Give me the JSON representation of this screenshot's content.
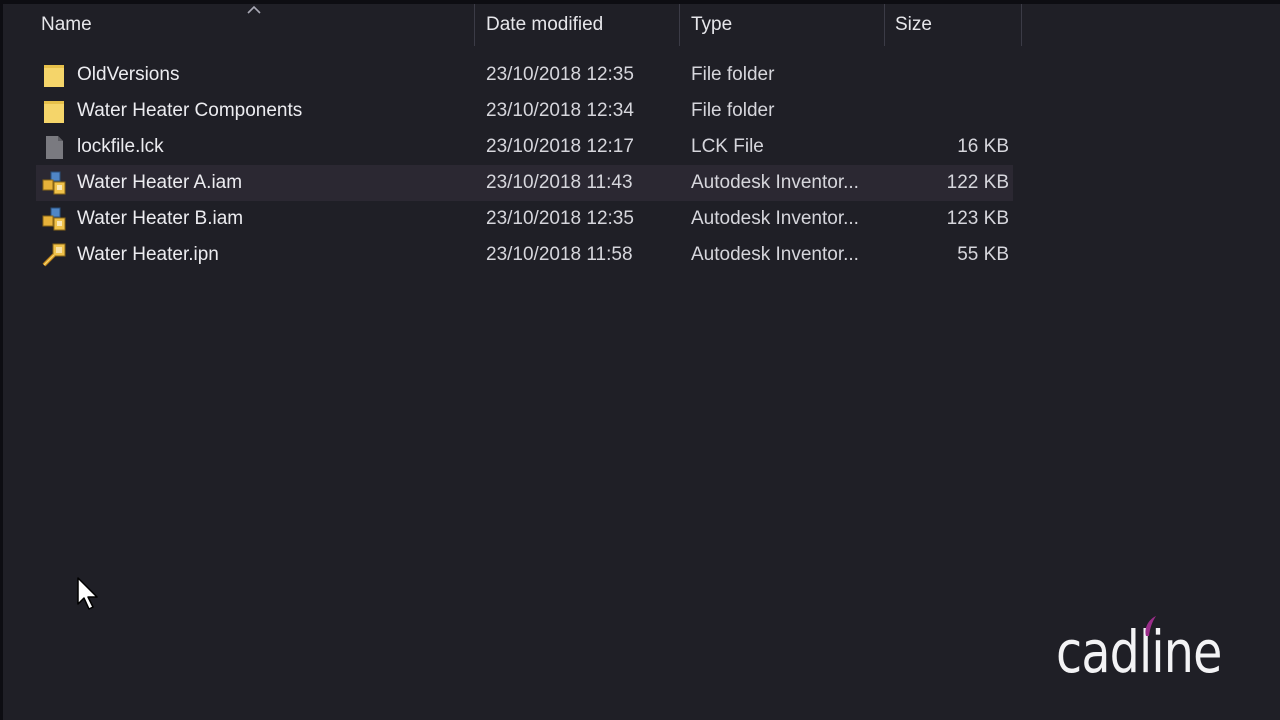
{
  "columns": {
    "name": "Name",
    "date_modified": "Date modified",
    "type": "Type",
    "size": "Size"
  },
  "sort": {
    "column": "name",
    "direction": "ascending",
    "icon": "chevron-up-icon"
  },
  "files": [
    {
      "name": "OldVersions",
      "date": "23/10/2018 12:35",
      "type": "File folder",
      "size": "",
      "icon": "folder-icon"
    },
    {
      "name": "Water Heater Components",
      "date": "23/10/2018 12:34",
      "type": "File folder",
      "size": "",
      "icon": "folder-icon"
    },
    {
      "name": "lockfile.lck",
      "date": "23/10/2018 12:17",
      "type": "LCK File",
      "size": "16 KB",
      "icon": "generic-file-icon"
    },
    {
      "name": "Water Heater A.iam",
      "date": "23/10/2018 11:43",
      "type": "Autodesk Inventor...",
      "size": "122 KB",
      "icon": "inventor-assembly-icon",
      "hovered": true
    },
    {
      "name": "Water Heater B.iam",
      "date": "23/10/2018 12:35",
      "type": "Autodesk Inventor...",
      "size": "123 KB",
      "icon": "inventor-assembly-icon"
    },
    {
      "name": "Water Heater.ipn",
      "date": "23/10/2018 11:58",
      "type": "Autodesk Inventor...",
      "size": "55 KB",
      "icon": "inventor-presentation-icon"
    }
  ],
  "watermark": {
    "text": "cadline",
    "accent_color": "#9b2d8a"
  },
  "colors": {
    "background": "#1f1f26",
    "hover_row": "#2b2832",
    "folder": "#f5d56a"
  }
}
